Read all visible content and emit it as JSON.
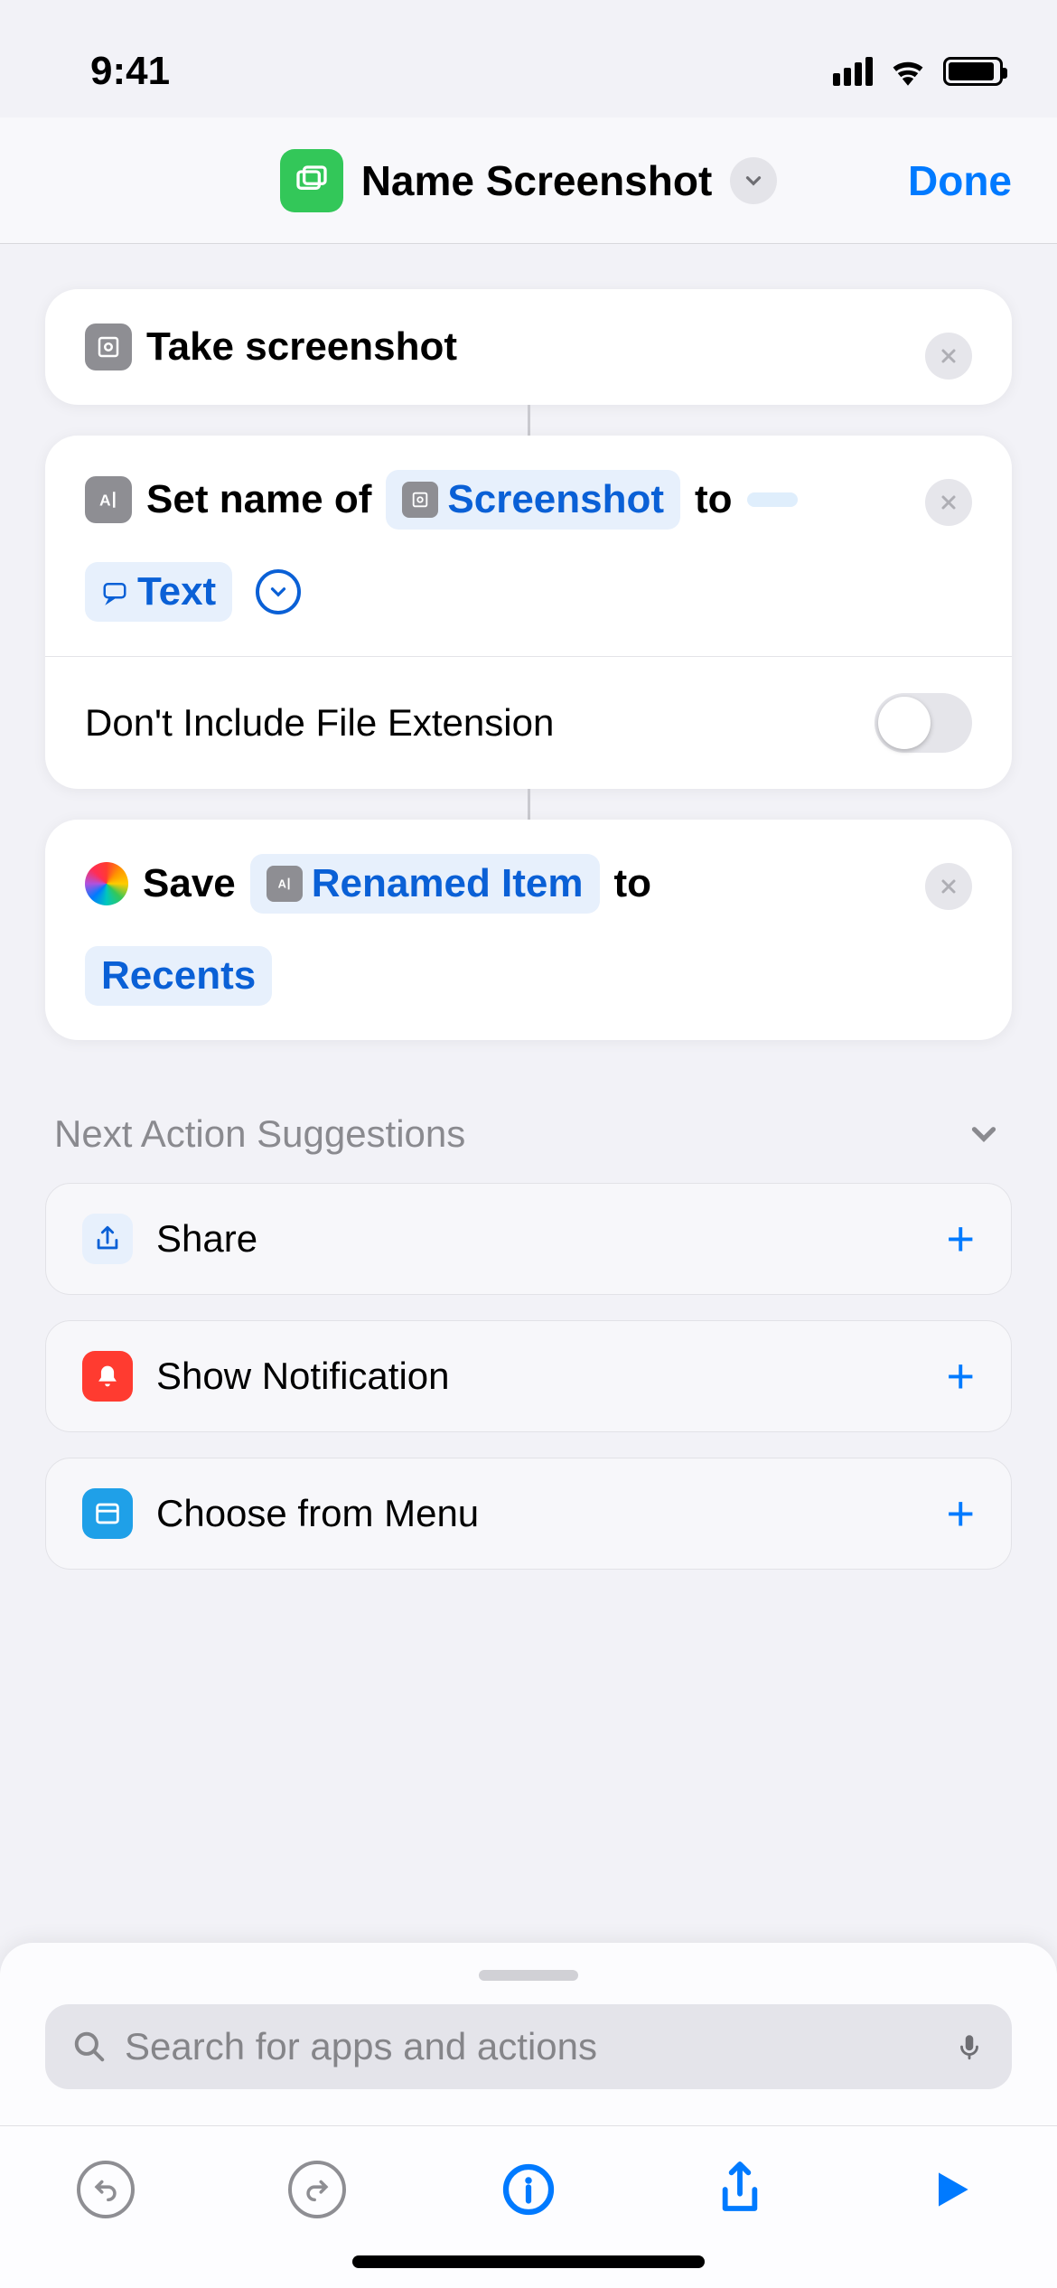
{
  "status": {
    "time": "9:41"
  },
  "header": {
    "title": "Name Screenshot",
    "done": "Done"
  },
  "actions": {
    "a1": {
      "title": "Take screenshot"
    },
    "a2": {
      "prefix": "Set name of",
      "token1": "Screenshot",
      "mid": "to",
      "token2": "Text",
      "option_label": "Don't Include File Extension"
    },
    "a3": {
      "prefix": "Save",
      "token1": "Renamed Item",
      "mid": "to",
      "token2": "Recents"
    }
  },
  "suggestions": {
    "header": "Next Action Suggestions",
    "items": [
      {
        "label": "Share"
      },
      {
        "label": "Show Notification"
      },
      {
        "label": "Choose from Menu"
      }
    ]
  },
  "search": {
    "placeholder": "Search for apps and actions"
  }
}
